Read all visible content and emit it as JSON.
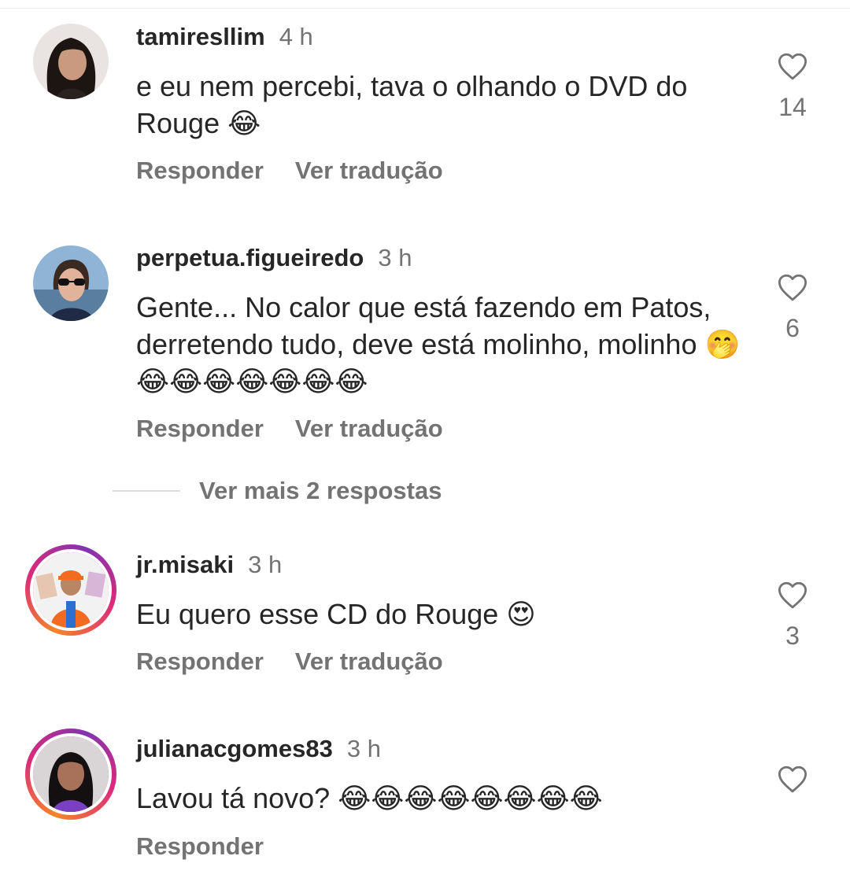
{
  "comments": [
    {
      "username": "tamiresllim",
      "time": "4 h",
      "text": "e eu nem percebi, tava o olhando o DVD do Rouge 😂",
      "likes": "14",
      "actions": [
        "Responder",
        "Ver tradução"
      ],
      "avatar": "woman-dark-hair-avatar"
    },
    {
      "username": "perpetua.figueiredo",
      "time": "3 h",
      "text": "Gente... No calor que está fazendo em Patos, derretendo tudo, deve está molinho, molinho 🤭😂😂😂😂😂😂😂",
      "likes": "6",
      "actions": [
        "Responder",
        "Ver tradução"
      ],
      "avatar": "woman-sunglasses-avatar"
    },
    {
      "username": "jr.misaki",
      "time": "3 h",
      "text": "Eu quero esse CD do Rouge 😍",
      "likes": "3",
      "actions": [
        "Responder",
        "Ver tradução"
      ],
      "avatar": "man-orange-cap-avatar"
    },
    {
      "username": "julianacgomes83",
      "time": "3 h",
      "text": "Lavou tá novo? 😂😂😂😂😂😂😂😂",
      "likes": "",
      "actions": [
        "Responder"
      ],
      "avatar": "woman-purple-top-avatar"
    }
  ],
  "more_replies_label": "Ver mais 2 respostas",
  "colors": {
    "text": "#262626",
    "secondary": "#737373",
    "story_ring": [
      "#f58529",
      "#dd2a7b",
      "#8134af"
    ]
  }
}
